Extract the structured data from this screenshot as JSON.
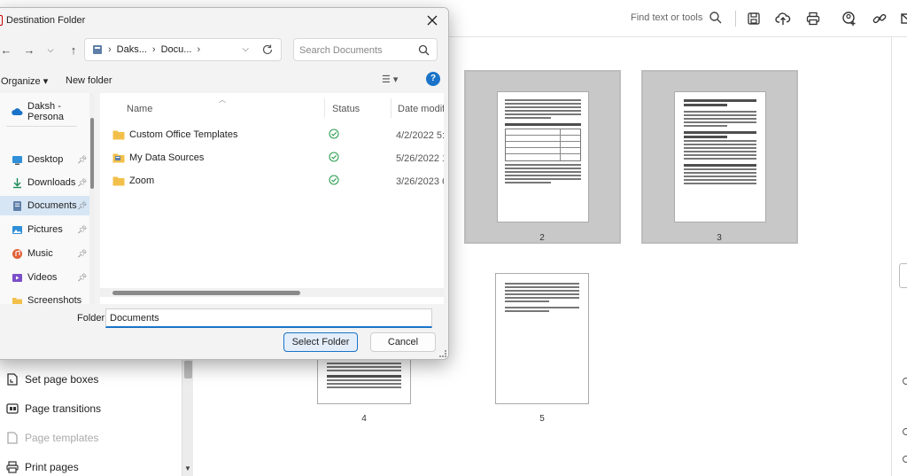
{
  "app": {
    "search_placeholder": "Find text or tools",
    "left_panel": [
      {
        "label": "Set page boxes",
        "icon": "set-page-boxes-icon",
        "disabled": false
      },
      {
        "label": "Page transitions",
        "icon": "page-transitions-icon",
        "disabled": false
      },
      {
        "label": "Page templates",
        "icon": "page-templates-icon",
        "disabled": true
      },
      {
        "label": "Print pages",
        "icon": "print-pages-icon",
        "disabled": false
      }
    ],
    "pages": [
      {
        "number": "2",
        "selected": true
      },
      {
        "number": "3",
        "selected": true
      },
      {
        "number": "4",
        "selected": false
      },
      {
        "number": "5",
        "selected": false
      }
    ]
  },
  "dialog": {
    "title": "Destination Folder",
    "breadcrumb": [
      "Daks...",
      "Docu..."
    ],
    "search_placeholder": "Search Documents",
    "commands": {
      "organize": "Organize ▾",
      "new_folder": "New folder"
    },
    "nav_items": [
      {
        "label": "Daksh - Persona",
        "icon": "onedrive-cloud-icon",
        "pinned": false,
        "active": false
      },
      {
        "label": "Desktop",
        "icon": "desktop-icon",
        "pinned": true,
        "active": false
      },
      {
        "label": "Downloads",
        "icon": "downloads-icon",
        "pinned": true,
        "active": false
      },
      {
        "label": "Documents",
        "icon": "documents-icon",
        "pinned": true,
        "active": true
      },
      {
        "label": "Pictures",
        "icon": "pictures-icon",
        "pinned": true,
        "active": false
      },
      {
        "label": "Music",
        "icon": "music-icon",
        "pinned": true,
        "active": false
      },
      {
        "label": "Videos",
        "icon": "videos-icon",
        "pinned": true,
        "active": false
      },
      {
        "label": "Screenshots",
        "icon": "screenshots-folder-icon",
        "pinned": false,
        "active": false
      }
    ],
    "columns": {
      "name": "Name",
      "status": "Status",
      "date": "Date modifi"
    },
    "files": [
      {
        "name": "Custom Office Templates",
        "status": "synced",
        "date": "4/2/2022 5:"
      },
      {
        "name": "My Data Sources",
        "status": "synced",
        "date": "5/26/2022 1"
      },
      {
        "name": "Zoom",
        "status": "synced",
        "date": "3/26/2023 6"
      }
    ],
    "folder_label": "Folder:",
    "folder_value": "Documents",
    "buttons": {
      "select": "Select Folder",
      "cancel": "Cancel"
    }
  },
  "colors": {
    "accent": "#1a73c8",
    "selected_nav": "#d6e6f5",
    "status_ok": "#2e9d4f"
  }
}
